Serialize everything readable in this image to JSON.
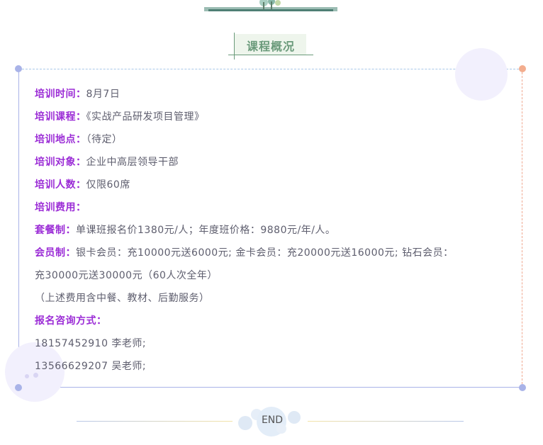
{
  "section_title": "课程概况",
  "rows": [
    {
      "label": "培训时间：",
      "value": "8月7日"
    },
    {
      "label": "培训课程：",
      "value": "《实战产品研发项目管理》"
    },
    {
      "label": "培训地点：",
      "value": "（待定）"
    },
    {
      "label": "培训对象：",
      "value": "企业中高层领导干部"
    },
    {
      "label": "培训人数：",
      "value": "仅限60席"
    },
    {
      "label": "培训费用：",
      "value": ""
    },
    {
      "label": "套餐制：",
      "value": "单课班报名价1380元/人；年度班价格：9880元/年/人。"
    },
    {
      "label": "会员制：",
      "value": "银卡会员：充10000元送6000元; 金卡会员：充20000元送16000元; 钻石会员："
    },
    {
      "label": "",
      "value": "充30000元送30000元（60人次全年）"
    },
    {
      "label": "",
      "value": "（上述费用含中餐、教材、后勤服务）"
    },
    {
      "label": "报名咨询方式：",
      "value": ""
    },
    {
      "label": "",
      "value": "18157452910 李老师;"
    },
    {
      "label": "",
      "value": "13566629207 吴老师;"
    }
  ],
  "end_text": "END",
  "colors": {
    "label": "#9b2cd6",
    "text": "#5e5e6e",
    "title": "#6a9a7a",
    "border": "#a9b3e8",
    "dash_right": "#f0a890"
  }
}
